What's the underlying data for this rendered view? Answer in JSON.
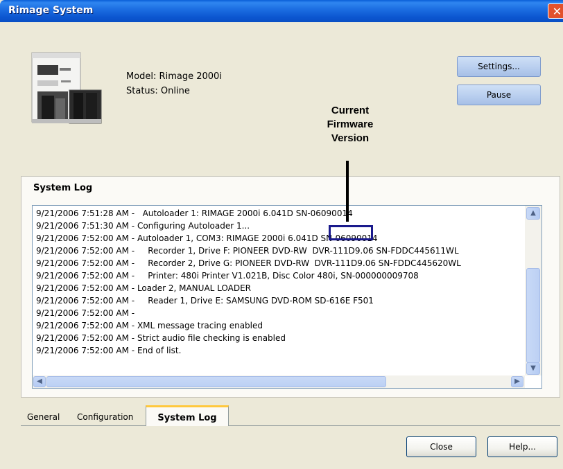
{
  "window": {
    "title": "Rimage System"
  },
  "device": {
    "model": "Model: Rimage 2000i",
    "status": "Status: Online"
  },
  "buttons": {
    "settings": "Settings...",
    "pause": "Pause",
    "close": "Close",
    "help": "Help..."
  },
  "annotation": {
    "line1": "Current",
    "line2": "Firmware",
    "line3": "Version"
  },
  "system_log": {
    "title": "System Log",
    "lines": [
      "9/21/2006 7:51:28 AM -   Autoloader 1: RIMAGE 2000i 6.041D SN-06090014",
      "9/21/2006 7:51:30 AM - Configuring Autoloader 1...",
      "9/21/2006 7:52:00 AM - Autoloader 1, COM3: RIMAGE 2000i 6.041D SN-06090014",
      "9/21/2006 7:52:00 AM -     Recorder 1, Drive F: PIONEER DVD-RW  DVR-111D9.06 SN-FDDC445611WL",
      "9/21/2006 7:52:00 AM -     Recorder 2, Drive G: PIONEER DVD-RW  DVR-111D9.06 SN-FDDC445620WL",
      "9/21/2006 7:52:00 AM -     Printer: 480i Printer V1.021B, Disc Color 480i, SN-000000009708",
      "9/21/2006 7:52:00 AM - Loader 2, MANUAL LOADER",
      "9/21/2006 7:52:00 AM -     Reader 1, Drive E: SAMSUNG DVD-ROM SD-616E F501",
      "9/21/2006 7:52:00 AM -",
      "9/21/2006 7:52:00 AM - XML message tracing enabled",
      "9/21/2006 7:52:00 AM - Strict audio file checking is enabled",
      "9/21/2006 7:52:00 AM - End of list."
    ]
  },
  "tabs": {
    "general": "General",
    "configuration": "Configuration",
    "system_log": "System Log"
  },
  "colors": {
    "titlebar": "#0a55cf",
    "window_bg": "#ece9d8",
    "annotation_box": "#1a1a8c",
    "active_tab_accent": "#ffc83c"
  },
  "icons": [
    "close-icon",
    "printer-device-icon",
    "scroll-up-icon",
    "scroll-down-icon",
    "scroll-left-icon",
    "scroll-right-icon"
  ]
}
